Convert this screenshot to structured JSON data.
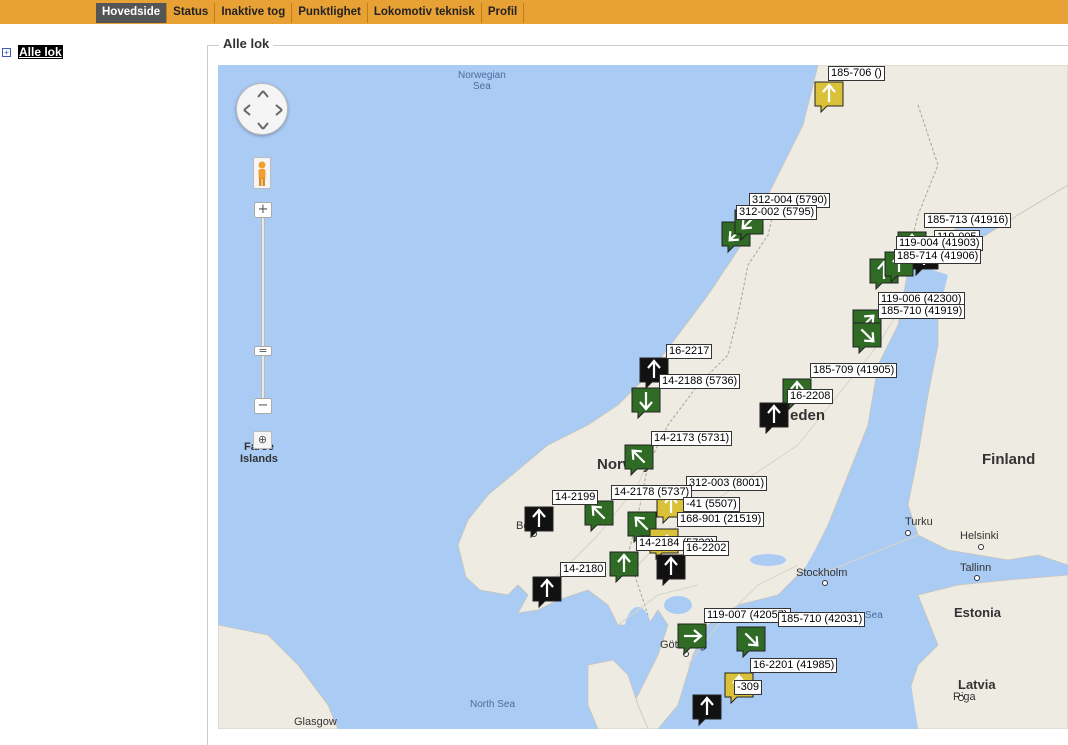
{
  "nav": {
    "items": [
      {
        "label": "Hovedside",
        "active": true
      },
      {
        "label": "Status",
        "active": false
      },
      {
        "label": "Inaktive tog",
        "active": false
      },
      {
        "label": "Punktlighet",
        "active": false
      },
      {
        "label": "Lokomotiv teknisk",
        "active": false
      },
      {
        "label": "Profil",
        "active": false
      }
    ]
  },
  "sidebar": {
    "toggle": "+",
    "root_label": "Alle lok"
  },
  "panel": {
    "legend": "Alle lok"
  },
  "map": {
    "seas": {
      "norwegian_sea_1": "Norwegian",
      "norwegian_sea_2": "Sea",
      "north_sea": "North Sea",
      "baltic_sea": "ltic Sea"
    },
    "countries": {
      "norway": "Norway",
      "sweden": "eden",
      "finland": "Finland",
      "estonia": "Estonia",
      "latvia": "Latvia"
    },
    "cities": {
      "faroe_1": "Faroe",
      "faroe_2": "Islands",
      "bergen": "Bergen",
      "turku": "Turku",
      "helsinki": "Helsinki",
      "tallinn": "Tallinn",
      "stockholm": "Stockholm",
      "goteborg": "Göteborg",
      "riga": "Riga",
      "glasgow": "Glasgow"
    },
    "zoom_plus": "+",
    "zoom_minus": "−",
    "labels": [
      "185-706 ()",
      "312-004 (5790)",
      "312-002 (5795)",
      "185-713 (41916)",
      "119-005",
      "119-004 (41903)",
      "185-714 (41906)",
      "119-006 (42300)",
      "185-710 (41919)",
      "16-2217",
      "14-2188 (5736)",
      "185-709 (41905)",
      "16-2208",
      "14-2173 (5731)",
      "312-003 (8001)",
      "14-2199",
      "14-2178 (5737)",
      "-41 (5507)",
      "168-901 (21519)",
      "14-2184 (5732)",
      "16-2202",
      "14-2180",
      "119-007 (42057)",
      "185-710 (42031)",
      "16-2201 (41985)",
      "-309"
    ]
  },
  "colors": {
    "topbar": "#e8a135",
    "water": "#aacbf4",
    "land": "#eeece2",
    "marker_green": "#2f6b25",
    "marker_black": "#111111",
    "marker_yellow": "#d9c23a"
  }
}
